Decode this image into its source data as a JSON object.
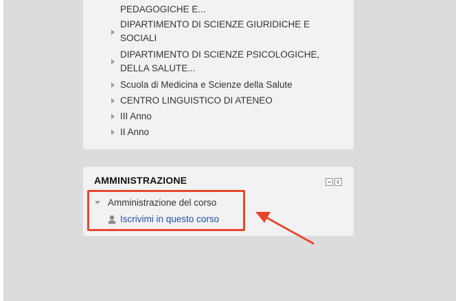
{
  "navigation": {
    "items": [
      {
        "label": "PEDAGOGICHE E..."
      },
      {
        "label_line1": "DIPARTIMENTO DI SCIENZE GIURIDICHE E",
        "label_line2": "SOCIALI"
      },
      {
        "label_line1": "DIPARTIMENTO DI SCIENZE PSICOLOGICHE,",
        "label_line2": "DELLA SALUTE..."
      },
      {
        "label": "Scuola di Medicina e Scienze della Salute"
      },
      {
        "label": "CENTRO LINGUISTICO DI ATENEO"
      },
      {
        "label": "III Anno"
      },
      {
        "label": "II Anno"
      }
    ]
  },
  "administration": {
    "title": "AMMINISTRAZIONE",
    "course_admin_label": "Amministrazione del corso",
    "enrol_link": "Iscrivimi in questo corso"
  },
  "colors": {
    "highlight": "#e8452c",
    "link": "#1f4fa8",
    "background": "#dcdcdc",
    "block": "#f2f2f2"
  },
  "icons": {
    "collapse": "minus-box-icon",
    "dock": "chevron-left-box-icon",
    "user": "user-icon"
  }
}
